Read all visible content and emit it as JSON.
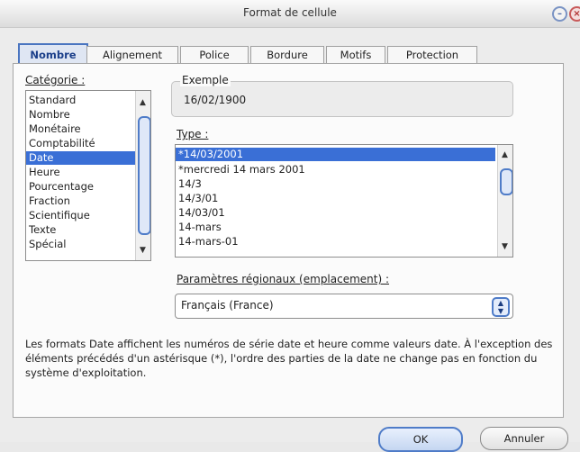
{
  "window": {
    "title": "Format de cellule"
  },
  "tabs": [
    {
      "label": "Nombre",
      "active": true
    },
    {
      "label": "Alignement",
      "active": false
    },
    {
      "label": "Police",
      "active": false
    },
    {
      "label": "Bordure",
      "active": false
    },
    {
      "label": "Motifs",
      "active": false
    },
    {
      "label": "Protection",
      "active": false
    }
  ],
  "category": {
    "label": "Catégorie :",
    "items": [
      "Standard",
      "Nombre",
      "Monétaire",
      "Comptabilité",
      "Date",
      "Heure",
      "Pourcentage",
      "Fraction",
      "Scientifique",
      "Texte",
      "Spécial"
    ],
    "selected": "Date"
  },
  "sample": {
    "label": "Exemple",
    "value": "16/02/1900"
  },
  "type": {
    "label": "Type :",
    "items": [
      "*14/03/2001",
      "*mercredi 14 mars 2001",
      "14/3",
      "14/3/01",
      "14/03/01",
      "14-mars",
      "14-mars-01"
    ],
    "selected": "*14/03/2001"
  },
  "locale": {
    "label": "Paramètres régionaux (emplacement) :",
    "value": "Français (France)"
  },
  "description": "Les formats Date affichent les numéros de série date et heure comme valeurs date. À l'exception des éléments précédés d'un astérisque (*), l'ordre des parties de la date ne change pas en fonction du système d'exploitation.",
  "buttons": {
    "ok": "OK",
    "cancel": "Annuler"
  }
}
